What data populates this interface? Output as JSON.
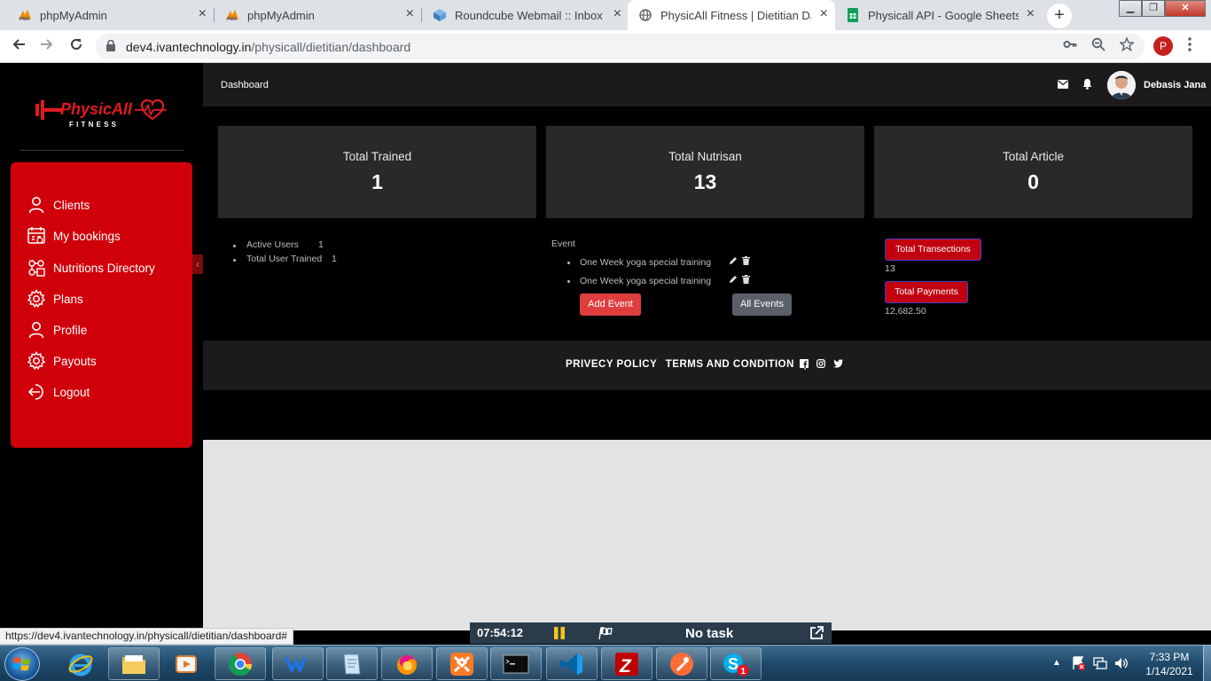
{
  "browser": {
    "tabs": [
      {
        "title": "phpMyAdmin",
        "favicon": "pma-icon",
        "active": false
      },
      {
        "title": "phpMyAdmin",
        "favicon": "pma-icon",
        "active": false
      },
      {
        "title": "Roundcube Webmail :: Inbox",
        "favicon": "roundcube-icon",
        "active": false
      },
      {
        "title": "PhysicAll Fitness | Dietitian Dash",
        "favicon": "globe-icon",
        "active": true
      },
      {
        "title": "Physicall API - Google Sheets",
        "favicon": "sheets-icon",
        "active": false
      }
    ],
    "url_host": "dev4.ivantechnology.in",
    "url_path": "/physicall/dietitian/dashboard",
    "profile_initial": "P",
    "status_url": "https://dev4.ivantechnology.in/physicall/dietitian/dashboard#"
  },
  "app": {
    "logo_text": "PhysicAll",
    "logo_sub": "FITNESS",
    "menu": [
      {
        "label": "Clients",
        "icon": "user-icon"
      },
      {
        "label": "My bookings",
        "icon": "bookings-icon"
      },
      {
        "label": "Nutritions Directory",
        "icon": "directory-icon"
      },
      {
        "label": "Plans",
        "icon": "gear-icon"
      },
      {
        "label": "Profile",
        "icon": "user-icon"
      },
      {
        "label": "Payouts",
        "icon": "gear-icon"
      },
      {
        "label": "Logout",
        "icon": "logout-icon"
      }
    ],
    "topbar": {
      "title": "Dashboard",
      "user_name": "Debasis Jana"
    },
    "cards": [
      {
        "title": "Total Trained",
        "value": "1"
      },
      {
        "title": "Total Nutrisan",
        "value": "13"
      },
      {
        "title": "Total Article",
        "value": "0"
      }
    ],
    "stats": [
      {
        "label": "Active Users",
        "value": "1"
      },
      {
        "label": "Total User Trained",
        "value": "1"
      }
    ],
    "events": {
      "heading": "Event",
      "items": [
        "One Week yoga special training",
        "One Week yoga special training"
      ],
      "add_label": "Add Event",
      "all_label": "All Events"
    },
    "totals": [
      {
        "label": "Total Transections",
        "value": "13"
      },
      {
        "label": "Total Payments",
        "value": "12,682.50"
      }
    ],
    "footer": {
      "privacy": "PRIVECY POLICY",
      "terms": "TERMS AND CONDITION",
      "sep": "|"
    },
    "colors": {
      "brand_red": "#d0000b",
      "dark": "#1c1a1a",
      "card": "#2b2829",
      "add_btn": "#e03e3e",
      "all_btn": "#5b5e6b"
    }
  },
  "timer": {
    "time": "07:54:12",
    "task": "No task"
  },
  "taskbar": {
    "apps": [
      "ie-icon",
      "explorer-icon",
      "media-icon",
      "chrome-icon",
      "wps-icon",
      "notepad-icon",
      "firefox-dev-icon",
      "xampp-icon",
      "cmd-icon",
      "vscode-icon",
      "filezilla-icon",
      "postman-icon",
      "skype-icon"
    ],
    "skype_badge": "1",
    "time": "7:33 PM",
    "date": "1/14/2021"
  }
}
